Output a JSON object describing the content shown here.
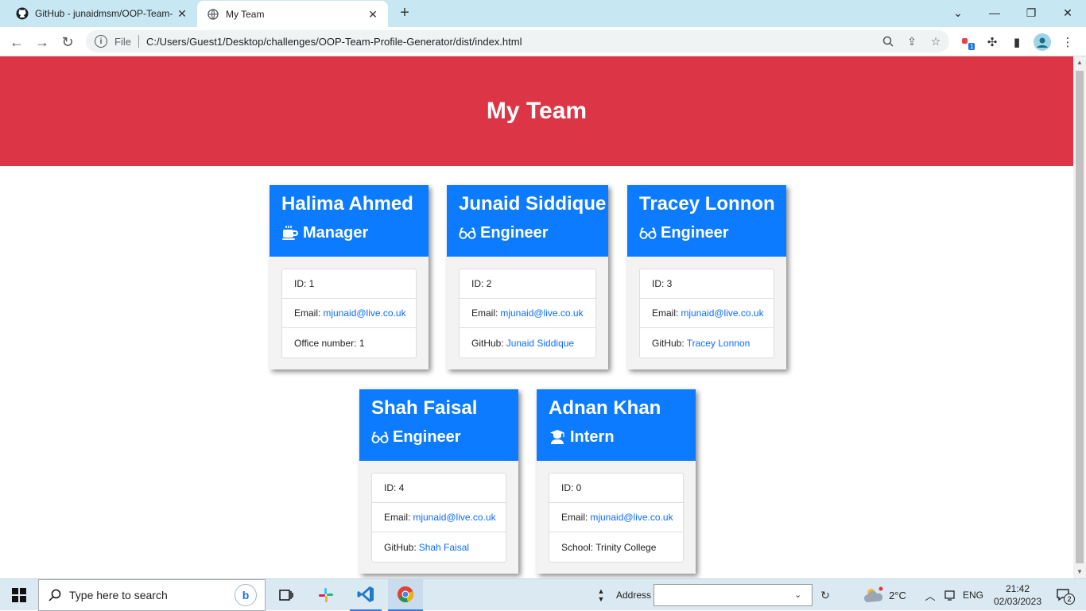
{
  "browser": {
    "tabs": [
      {
        "title": "GitHub - junaidmsm/OOP-Team-",
        "active": false
      },
      {
        "title": "My Team",
        "active": true
      }
    ],
    "new_tab": "+",
    "omnibox": {
      "scheme_label": "File",
      "url": "C:/Users/Guest1/Desktop/challenges/OOP-Team-Profile-Generator/dist/index.html"
    },
    "extension_badge": "1"
  },
  "page": {
    "heading": "My Team",
    "colors": {
      "header_bg": "#dc3545",
      "card_head_bg": "#0d7bff",
      "link": "#0d6efd"
    },
    "cards": [
      {
        "name": "Halima Ahmed",
        "role": "Manager",
        "icon": "mug-icon",
        "id_label": "ID: 1",
        "email_label": "Email:",
        "email": "mjunaid@live.co.uk",
        "extra_label": "Office number: 1",
        "extra_link": ""
      },
      {
        "name": "Junaid Siddique",
        "role": "Engineer",
        "icon": "glasses-icon",
        "id_label": "ID: 2",
        "email_label": "Email:",
        "email": "mjunaid@live.co.uk",
        "extra_label": "GitHub:",
        "extra_link": "Junaid Siddique"
      },
      {
        "name": "Tracey Lonnon",
        "role": "Engineer",
        "icon": "glasses-icon",
        "id_label": "ID: 3",
        "email_label": "Email:",
        "email": "mjunaid@live.co.uk",
        "extra_label": "GitHub:",
        "extra_link": "Tracey Lonnon"
      },
      {
        "name": "Shah Faisal",
        "role": "Engineer",
        "icon": "glasses-icon",
        "id_label": "ID: 4",
        "email_label": "Email:",
        "email": "mjunaid@live.co.uk",
        "extra_label": "GitHub:",
        "extra_link": "Shah Faisal"
      },
      {
        "name": "Adnan Khan",
        "role": "Intern",
        "icon": "graduate-icon",
        "id_label": "ID: 0",
        "email_label": "Email:",
        "email": "mjunaid@live.co.uk",
        "extra_label": "School: Trinity College",
        "extra_link": ""
      }
    ]
  },
  "taskbar": {
    "search_placeholder": "Type here to search",
    "address_label": "Address",
    "weather": "2°C",
    "language": "ENG",
    "time": "21:42",
    "date": "02/03/2023",
    "notifications": "2"
  }
}
